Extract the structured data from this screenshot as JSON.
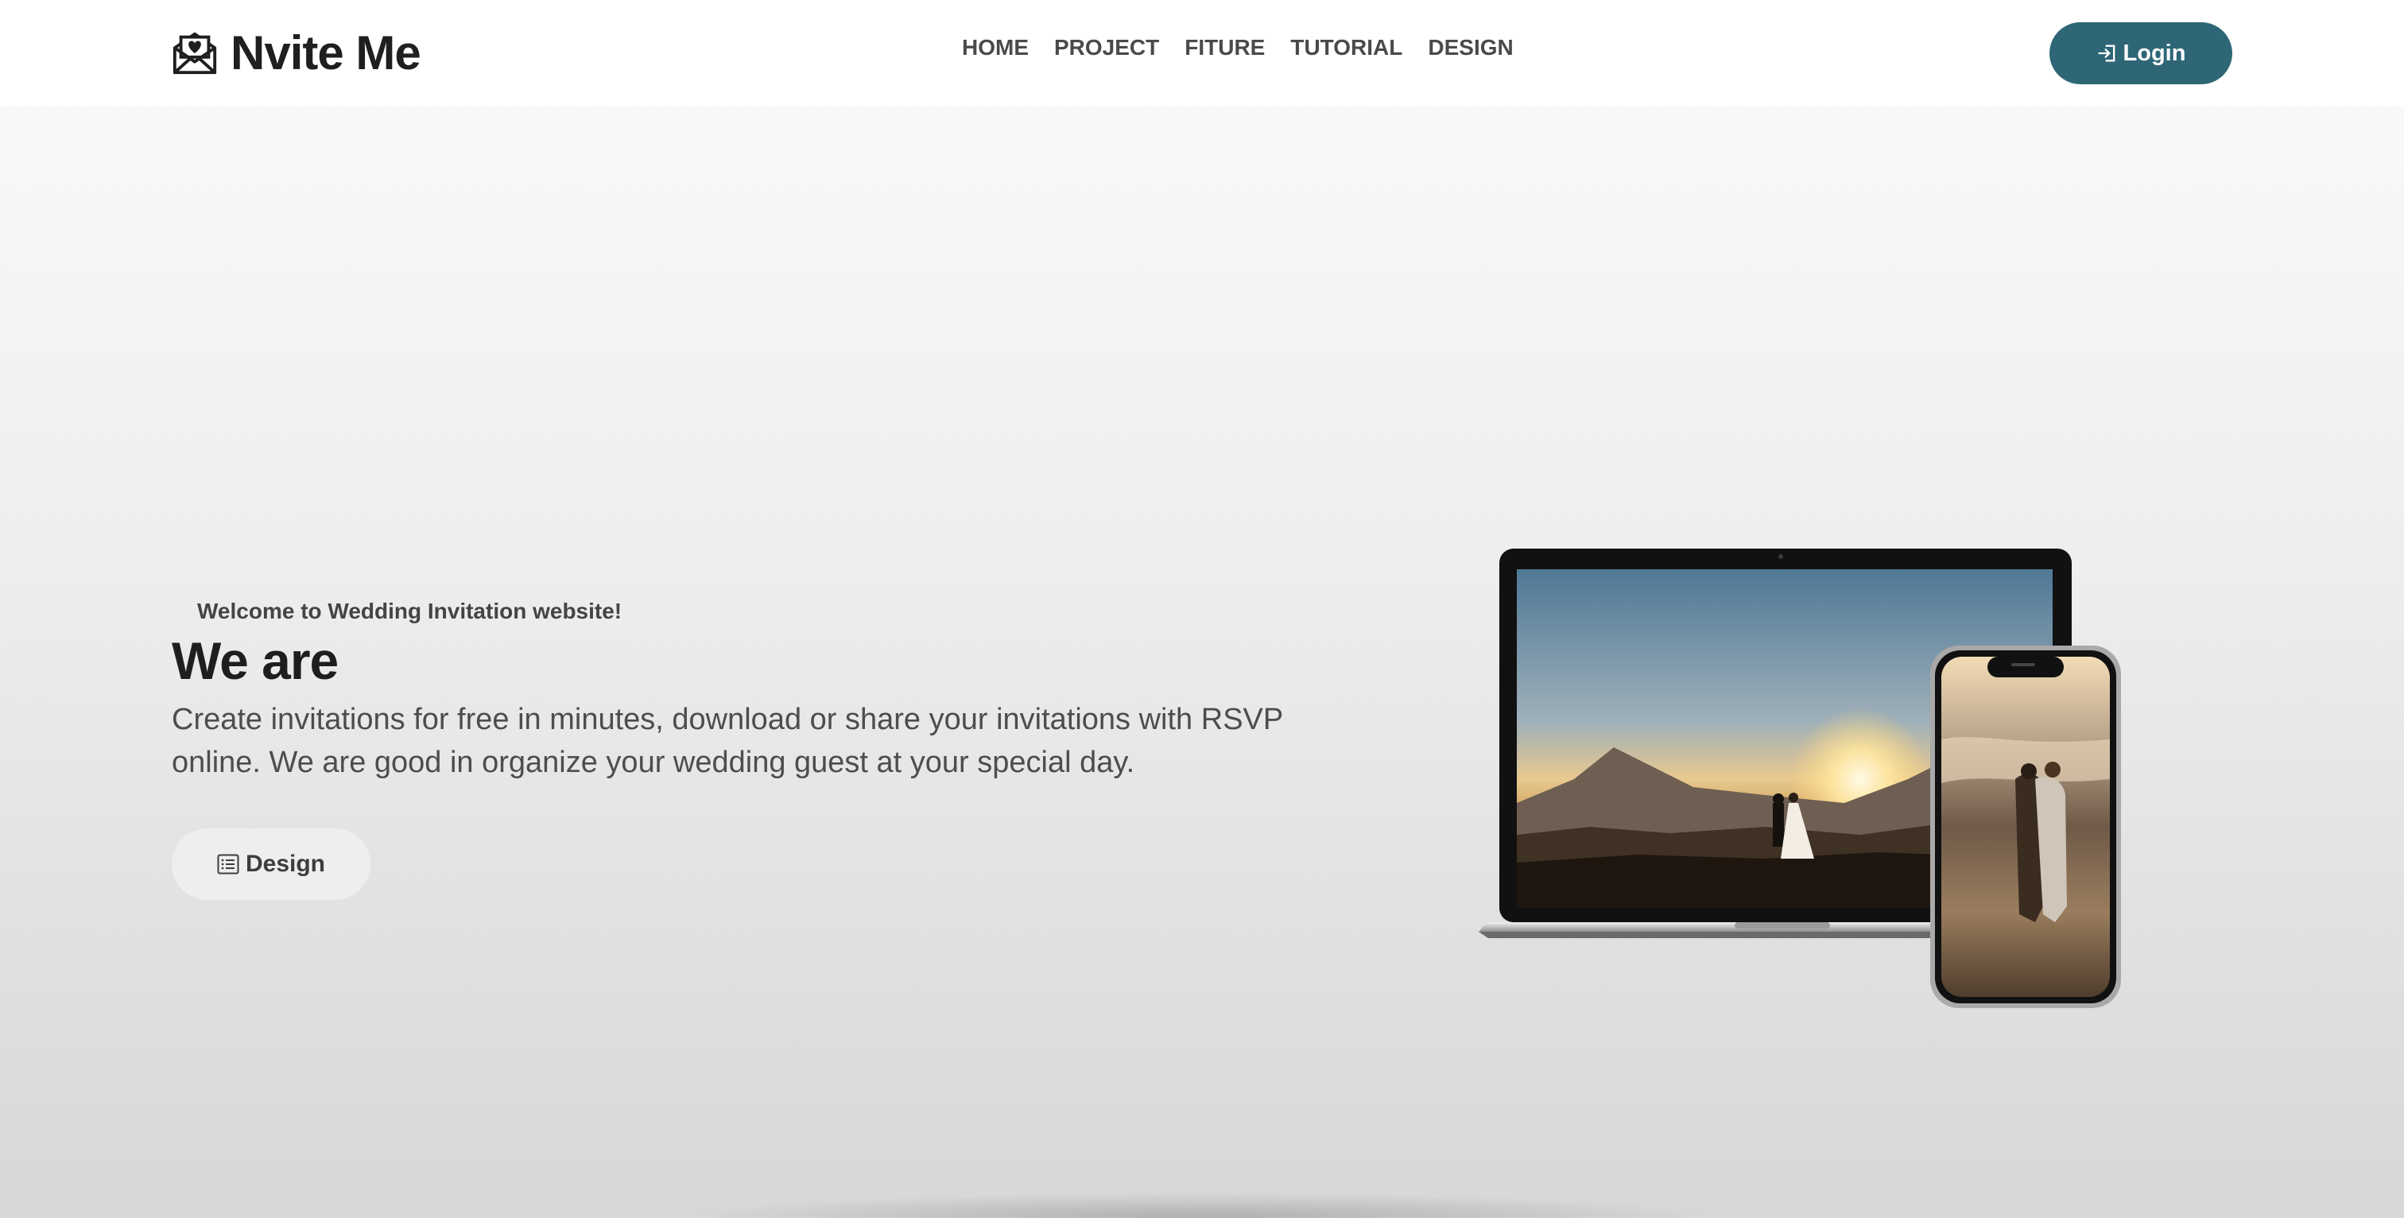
{
  "brand": {
    "name": "Nvite Me",
    "icon": "envelope-heart-icon"
  },
  "nav": {
    "items": [
      {
        "label": "HOME"
      },
      {
        "label": "PROJECT"
      },
      {
        "label": "FITURE"
      },
      {
        "label": "TUTORIAL"
      },
      {
        "label": "DESIGN"
      }
    ]
  },
  "login": {
    "label": "Login",
    "icon": "sign-in-icon",
    "color": "#2e6676"
  },
  "hero": {
    "welcome": "Welcome to Wedding Invitation website!",
    "headline": "We are",
    "description": "Create invitations for free in minutes, download or share your invitations with RSVP online. We are good in organize your wedding guest at your special day.",
    "design_button": {
      "label": "Design",
      "icon": "list-icon"
    }
  },
  "devices": {
    "laptop_image": "wedding-couple-sunset-photo",
    "phone_image": "wedding-couple-beach-photo"
  }
}
